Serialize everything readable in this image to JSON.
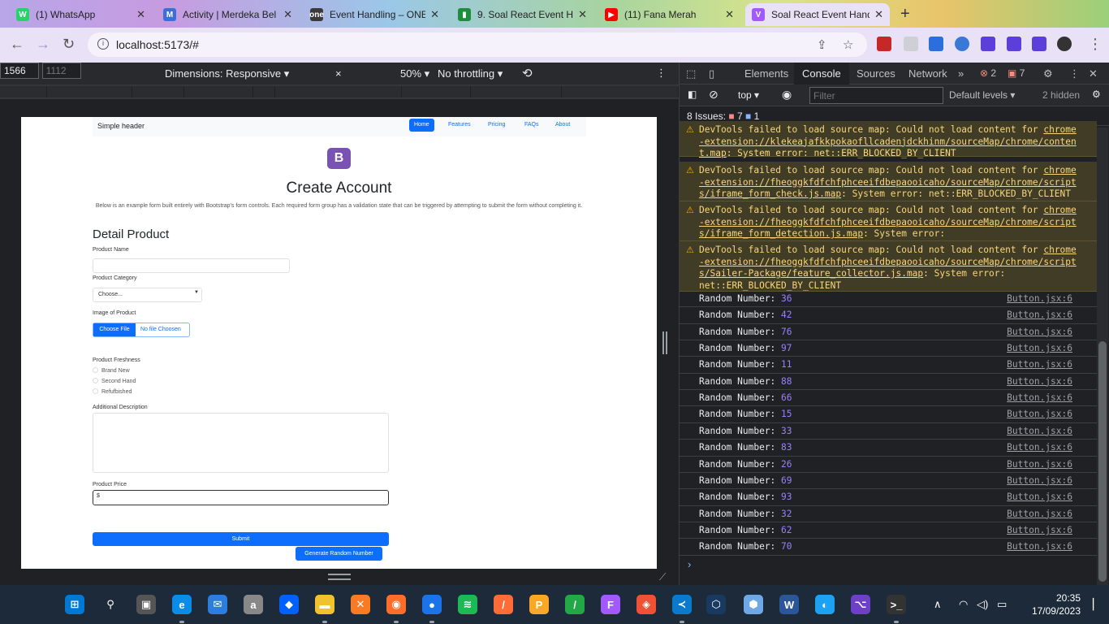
{
  "browser": {
    "tabs": [
      {
        "title": "(1) WhatsApp",
        "color": "#25d366",
        "glyph": "W"
      },
      {
        "title": "Activity | Merdeka Bel",
        "color": "#3b6fd6",
        "glyph": "M"
      },
      {
        "title": "Event Handling – ONE",
        "color": "#3a3a3a",
        "glyph": "one"
      },
      {
        "title": "9. Soal React Event Ha",
        "color": "#1e8e3e",
        "glyph": "▮"
      },
      {
        "title": "(11) Fana Merah",
        "color": "#ff0000",
        "glyph": "▶"
      },
      {
        "title": "Soal React Event Hand",
        "color": "#a259ff",
        "glyph": "V"
      }
    ],
    "url": "localhost:5173/#"
  },
  "device_toolbar": {
    "dimensions_label": "Dimensions: Responsive",
    "width": "1566",
    "height_placeholder": "1112",
    "zoom": "50%",
    "throttling": "No throttling"
  },
  "app": {
    "header": {
      "brand": "Simple header",
      "nav": [
        "Home",
        "Features",
        "Pricing",
        "FAQs",
        "About"
      ]
    },
    "logo_letter": "B",
    "title": "Create Account",
    "lead": "Below is an example form built entirely with Bootstrap's form controls. Each required form group has a validation state that can be triggered by attempting to submit the form without completing it.",
    "section_title": "Detail Product",
    "product_name_label": "Product Name",
    "product_category_label": "Product Category",
    "product_category_selected": "Choose...",
    "image_label": "Image of Product",
    "choose_file": "Choose File",
    "no_file": "No file Choosen",
    "freshness_label": "Product Freshness",
    "freshness_options": [
      "Brand New",
      "Second Hand",
      "Refufbished"
    ],
    "description_label": "Additional Description",
    "price_label": "Product Price",
    "price_prefix": "$",
    "submit": "Submit",
    "random_button": "Generate Random Number"
  },
  "devtools": {
    "tabs": [
      "Elements",
      "Console",
      "Sources",
      "Network"
    ],
    "error_count": "2",
    "warning_count": "7",
    "context": "top",
    "filter_placeholder": "Filter",
    "levels": "Default levels",
    "hidden": "2 hidden",
    "issues_label": "8 Issues:",
    "issues_warn": "7",
    "issues_info": "1",
    "warnings": [
      {
        "l1": "DevTools failed to load source map: Could not load content for ",
        "link": "chrome-extension://klekeajafkkpokaofllcadenjdckhinm/sourceMap/chrome/content.map",
        "l2": ": System error: net::ERR_BLOCKED_BY_CLIENT"
      },
      {
        "l1": "DevTools failed to load source map: Could not load content for ",
        "link": "chrome-extension://fheoggkfdfchfphceeifdbepaooicaho/sourceMap/chrome/scripts/iframe_form_check.js.map",
        "l2": ": System error: net::ERR_BLOCKED_BY_CLIENT"
      },
      {
        "l1": "DevTools failed to load source map: Could not load content for ",
        "link": "chrome-extension://fheoggkfdfchfphceeifdbepaooicaho/sourceMap/chrome/scripts/iframe_form_detection.js.map",
        "l2": ": System error: net::ERR_BLOCKED_BY_CLIENT"
      },
      {
        "l1": "DevTools failed to load source map: Could not load content for ",
        "link": "chrome-extension://fheoggkfdfchfphceeifdbepaooicaho/sourceMap/chrome/scripts/Sailer-Package/feature_collector.js.map",
        "l2": ": System error: net::ERR_BLOCKED_BY_CLIENT"
      }
    ],
    "log_label": "Random Number:",
    "log_source": "Button.jsx:6",
    "log_values": [
      "36",
      "42",
      "76",
      "97",
      "11",
      "88",
      "66",
      "15",
      "33",
      "83",
      "26",
      "69",
      "93",
      "32",
      "62",
      "70"
    ]
  },
  "taskbar": {
    "apps": [
      {
        "name": "start",
        "color": "#0078d4",
        "glyph": "⊞"
      },
      {
        "name": "search",
        "color": "#1c2a3a",
        "glyph": "⚲"
      },
      {
        "name": "task-view",
        "color": "#555",
        "glyph": "▣"
      },
      {
        "name": "edge",
        "color": "#0c8ce9",
        "glyph": "e"
      },
      {
        "name": "mail",
        "color": "#2d7de0",
        "glyph": "✉"
      },
      {
        "name": "store",
        "color": "#888",
        "glyph": "a"
      },
      {
        "name": "dropbox",
        "color": "#0061fe",
        "glyph": "◆"
      },
      {
        "name": "explorer",
        "color": "#f2c12e",
        "glyph": "▬"
      },
      {
        "name": "xampp",
        "color": "#fb7a24",
        "glyph": "✕"
      },
      {
        "name": "firefox",
        "color": "#ff6d2a",
        "glyph": "◉"
      },
      {
        "name": "chrome",
        "color": "#1a73e8",
        "glyph": "●"
      },
      {
        "name": "spotify",
        "color": "#1db954",
        "glyph": "≋"
      },
      {
        "name": "postman",
        "color": "#ff6c37",
        "glyph": "/"
      },
      {
        "name": "pinterest-app",
        "color": "#f9a825",
        "glyph": "P"
      },
      {
        "name": "notes-app",
        "color": "#22a846",
        "glyph": "/"
      },
      {
        "name": "figma",
        "color": "#a259ff",
        "glyph": "F"
      },
      {
        "name": "git-app",
        "color": "#f05033",
        "glyph": "◈"
      },
      {
        "name": "vscode",
        "color": "#0a7acc",
        "glyph": "≺"
      },
      {
        "name": "virtualbox",
        "color": "#183a61",
        "glyph": "⬡"
      },
      {
        "name": "box-app",
        "color": "#6ea8e6",
        "glyph": "⬢"
      },
      {
        "name": "word-app",
        "color": "#2b579a",
        "glyph": "W"
      },
      {
        "name": "bluetooth-app",
        "color": "#1da1f2",
        "glyph": "◐"
      },
      {
        "name": "github",
        "color": "#6e40c9",
        "glyph": "⌥"
      },
      {
        "name": "terminal",
        "color": "#333",
        "glyph": ">_"
      }
    ],
    "time": "20:35",
    "date": "17/09/2023"
  }
}
